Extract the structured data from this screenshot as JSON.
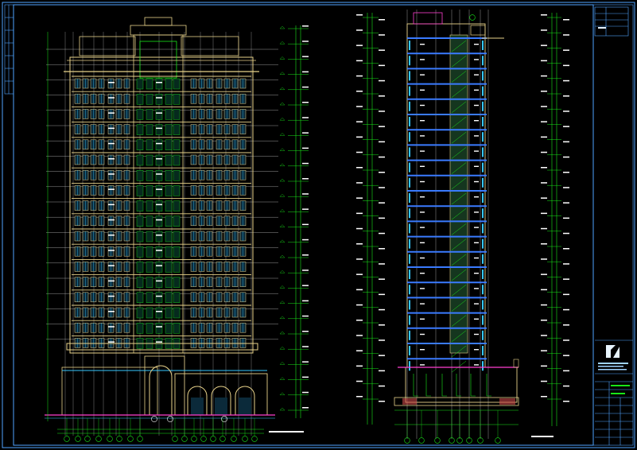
{
  "colors": {
    "background": "#000000",
    "frame": "#4fa3ff",
    "facade": "#e8d28a",
    "facade_dark": "#b99a4a",
    "window": "#35c7ff",
    "dimension": "#19e619",
    "grid_line": "#d9d9d9",
    "ground": "#ff3fd0",
    "slab": "#3a7bff",
    "hatch": "#c94a4a"
  },
  "icons": {
    "logo": "institute-logo-icon"
  }
}
